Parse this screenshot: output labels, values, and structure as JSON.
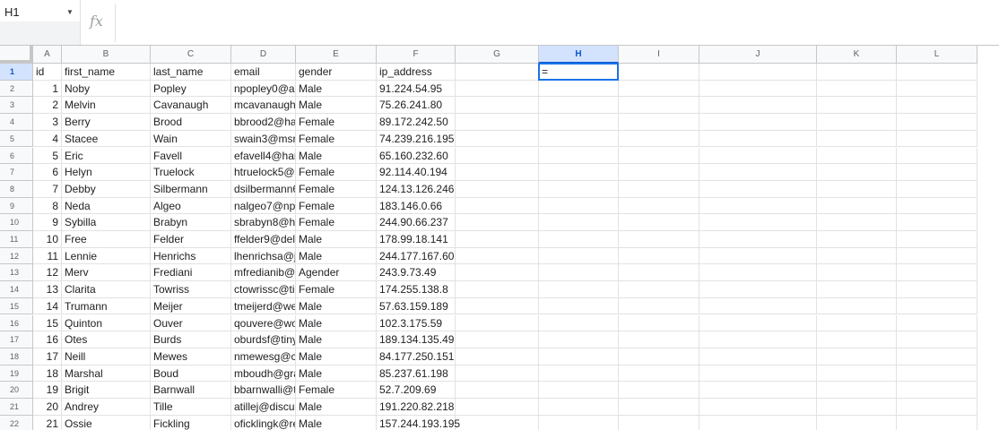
{
  "name_box": {
    "value": "H1"
  },
  "formula_bar": {
    "fx_label": "fx",
    "value": ""
  },
  "columns": [
    "A",
    "B",
    "C",
    "D",
    "E",
    "F",
    "G",
    "H",
    "I",
    "J",
    "K",
    "L"
  ],
  "selected_column": "H",
  "selected_row": 1,
  "active_cell": {
    "ref": "H1",
    "value": "="
  },
  "rows": [
    {
      "n": "1",
      "cells": [
        "id",
        "first_name",
        "last_name",
        "email",
        "gender",
        "ip_address"
      ]
    },
    {
      "n": "2",
      "cells": [
        "1",
        "Noby",
        "Popley",
        "npopley0@al",
        "Male",
        "91.224.54.95"
      ]
    },
    {
      "n": "3",
      "cells": [
        "2",
        "Melvin",
        "Cavanaugh",
        "mcavanaugh",
        "Male",
        "75.26.241.80"
      ]
    },
    {
      "n": "4",
      "cells": [
        "3",
        "Berry",
        "Brood",
        "bbrood2@ha",
        "Female",
        "89.172.242.50"
      ]
    },
    {
      "n": "5",
      "cells": [
        "4",
        "Stacee",
        "Wain",
        "swain3@msr",
        "Female",
        "74.239.216.195"
      ]
    },
    {
      "n": "6",
      "cells": [
        "5",
        "Eric",
        "Favell",
        "efavell4@har",
        "Male",
        "65.160.232.60"
      ]
    },
    {
      "n": "7",
      "cells": [
        "6",
        "Helyn",
        "Truelock",
        "htruelock5@",
        "Female",
        "92.114.40.194"
      ]
    },
    {
      "n": "8",
      "cells": [
        "7",
        "Debby",
        "Silbermann",
        "dsilbermann6",
        "Female",
        "124.13.126.246"
      ]
    },
    {
      "n": "9",
      "cells": [
        "8",
        "Neda",
        "Algeo",
        "nalgeo7@np:",
        "Female",
        "183.146.0.66"
      ]
    },
    {
      "n": "10",
      "cells": [
        "9",
        "Sybilla",
        "Brabyn",
        "sbrabyn8@h",
        "Female",
        "244.90.66.237"
      ]
    },
    {
      "n": "11",
      "cells": [
        "10",
        "Free",
        "Felder",
        "ffelder9@deli",
        "Male",
        "178.99.18.141"
      ]
    },
    {
      "n": "12",
      "cells": [
        "11",
        "Lennie",
        "Henrichs",
        "lhenrichsa@j",
        "Male",
        "244.177.167.60"
      ]
    },
    {
      "n": "13",
      "cells": [
        "12",
        "Merv",
        "Frediani",
        "mfredianib@l",
        "Agender",
        "243.9.73.49"
      ]
    },
    {
      "n": "14",
      "cells": [
        "13",
        "Clarita",
        "Towriss",
        "ctowrissc@ti",
        "Female",
        "174.255.138.8"
      ]
    },
    {
      "n": "15",
      "cells": [
        "14",
        "Trumann",
        "Meijer",
        "tmeijerd@we",
        "Male",
        "57.63.159.189"
      ]
    },
    {
      "n": "16",
      "cells": [
        "15",
        "Quinton",
        "Ouver",
        "qouvere@wo",
        "Male",
        "102.3.175.59"
      ]
    },
    {
      "n": "17",
      "cells": [
        "16",
        "Otes",
        "Burds",
        "oburdsf@tiny",
        "Male",
        "189.134.135.49"
      ]
    },
    {
      "n": "18",
      "cells": [
        "17",
        "Neill",
        "Mewes",
        "nmewesg@c",
        "Male",
        "84.177.250.151"
      ]
    },
    {
      "n": "19",
      "cells": [
        "18",
        "Marshal",
        "Boud",
        "mboudh@gra",
        "Male",
        "85.237.61.198"
      ]
    },
    {
      "n": "20",
      "cells": [
        "19",
        "Brigit",
        "Barnwall",
        "bbarnwalli@t",
        "Female",
        "52.7.209.69"
      ]
    },
    {
      "n": "21",
      "cells": [
        "20",
        "Andrey",
        "Tille",
        "atillej@discu",
        "Male",
        "191.220.82.218"
      ]
    },
    {
      "n": "22",
      "cells": [
        "21",
        "Ossie",
        "Fickling",
        "oficklingk@re",
        "Male",
        "157.244.193.195"
      ]
    }
  ]
}
